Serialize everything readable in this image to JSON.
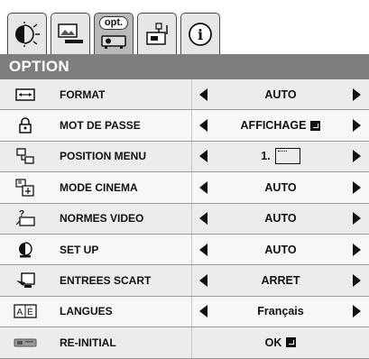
{
  "tabs": [
    {
      "name": "picture-tab",
      "icon": "brightness-icon",
      "active": false
    },
    {
      "name": "image-tab",
      "icon": "image-adjust-icon",
      "active": false
    },
    {
      "name": "option-tab",
      "icon": "projector-option-icon",
      "label": "opt.",
      "active": true
    },
    {
      "name": "install-tab",
      "icon": "installation-icon",
      "active": false
    },
    {
      "name": "info-tab",
      "icon": "info-icon",
      "active": false
    }
  ],
  "menu": {
    "title": "OPTION",
    "items": [
      {
        "key": "format",
        "icon": "aspect-ratio-icon",
        "label": "FORMAT",
        "value": "AUTO",
        "arrows": true
      },
      {
        "key": "password",
        "icon": "lock-icon",
        "label": "MOT DE PASSE",
        "value": "AFFICHAGE",
        "enter": true,
        "arrows": true
      },
      {
        "key": "menu-position",
        "icon": "menu-position-icon",
        "label": "POSITION MENU",
        "value": "1.",
        "position_box": true,
        "arrows": true
      },
      {
        "key": "cinema-mode",
        "icon": "cinema-mode-icon",
        "label": "MODE CINEMA",
        "value": "AUTO",
        "arrows": true
      },
      {
        "key": "video-standard",
        "icon": "video-standard-icon",
        "label": "NORMES VIDEO",
        "value": "AUTO",
        "arrows": true
      },
      {
        "key": "setup",
        "icon": "setup-level-icon",
        "label": "SET UP",
        "value": "AUTO",
        "arrows": true
      },
      {
        "key": "scart-input",
        "icon": "scart-input-icon",
        "label": "ENTREES SCART",
        "value": "ARRET",
        "arrows": true
      },
      {
        "key": "language",
        "icon": "language-icon",
        "label": "LANGUES",
        "value": "Français",
        "arrows": true
      },
      {
        "key": "reset",
        "icon": "reset-icon",
        "label": "RE-INITIAL",
        "value": "OK",
        "enter": true,
        "arrows": false
      }
    ]
  }
}
